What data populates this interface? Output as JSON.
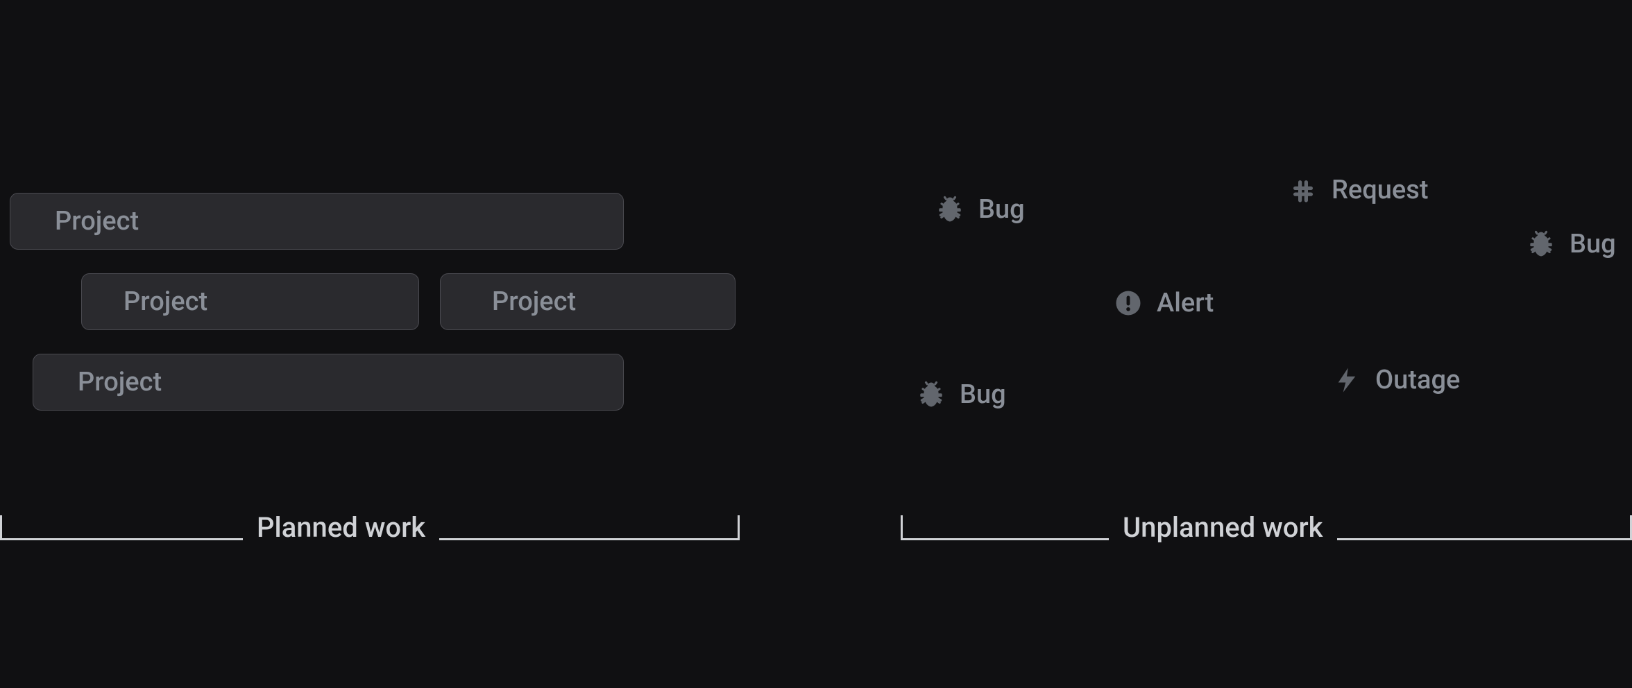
{
  "planned": {
    "caption": "Planned work",
    "bars": [
      {
        "label": "Project"
      },
      {
        "label": "Project"
      },
      {
        "label": "Project"
      },
      {
        "label": "Project"
      }
    ]
  },
  "unplanned": {
    "caption": "Unplanned work",
    "items": [
      {
        "label": "Bug",
        "icon": "bug-icon"
      },
      {
        "label": "Request",
        "icon": "slack-icon"
      },
      {
        "label": "Alert",
        "icon": "alert-icon"
      },
      {
        "label": "Bug",
        "icon": "bug-icon"
      },
      {
        "label": "Outage",
        "icon": "bolt-icon"
      },
      {
        "label": "Bug",
        "icon": "bug-icon"
      }
    ]
  }
}
